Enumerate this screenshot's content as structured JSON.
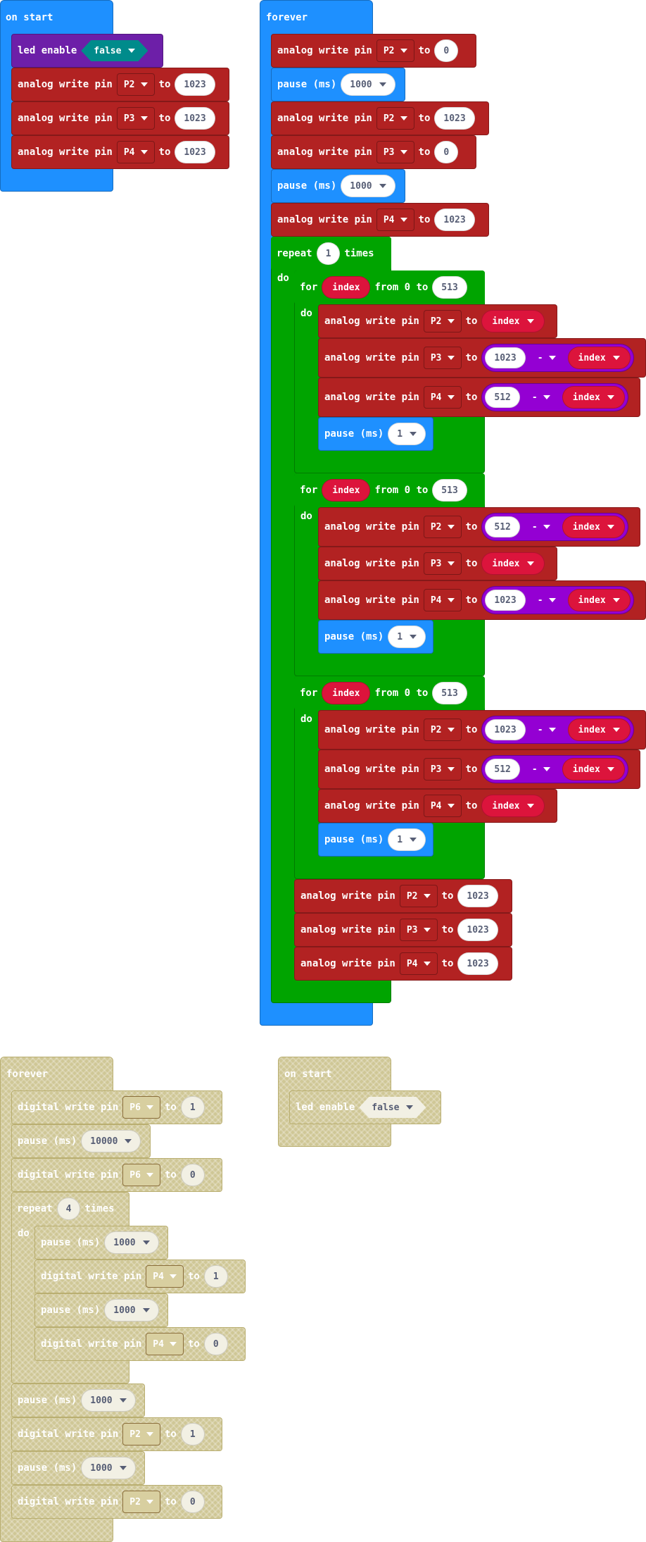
{
  "blocks": {
    "on_start_title": "on start",
    "forever_title": "forever",
    "led_enable": "led enable",
    "led_value": "false",
    "analog_write_pin": "analog write pin",
    "digital_write_pin": "digital write pin",
    "to": "to",
    "pause_ms": "pause (ms)",
    "repeat": "repeat",
    "times": "times",
    "do": "do",
    "for": "for",
    "from_0_to": "from 0 to",
    "minus": "-",
    "index": "index"
  },
  "pins": {
    "p2": "P2",
    "p3": "P3",
    "p4": "P4",
    "p6": "P6"
  },
  "values": {
    "v0": "0",
    "v1": "1",
    "v4": "4",
    "v512": "512",
    "v513": "513",
    "v1000": "1000",
    "v1023": "1023",
    "v10000": "10000"
  },
  "colors": {
    "pins_red": "#b22222",
    "basic_blue": "#1e90ff",
    "loops_green": "#00a400",
    "led_purple": "#6d1fa8",
    "math_purple": "#9400d3",
    "variable_red": "#dc143c",
    "logic_teal": "#008b8b",
    "disabled_khaki": "#cfc796"
  },
  "icons": {
    "dropdown": "caret-down-icon"
  }
}
